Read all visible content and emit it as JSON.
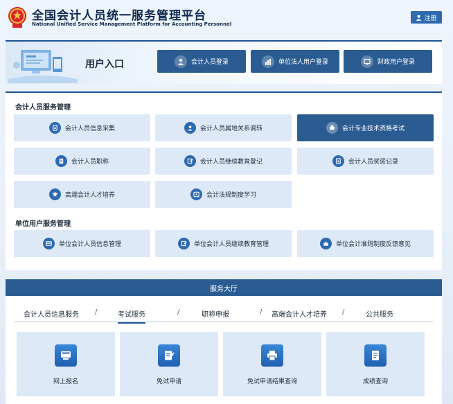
{
  "header": {
    "title": "全国会计人员统一服务管理平台",
    "subtitle": "National Unified Service Management Platform for Accounting Personnel",
    "register_label": "注册"
  },
  "login": {
    "title": "用户入口",
    "buttons": [
      {
        "label": "会计人员登录",
        "icon": "user-icon"
      },
      {
        "label": "单位法人用户登录",
        "icon": "building-icon"
      },
      {
        "label": "财政用户登录",
        "icon": "monitor-icon"
      }
    ]
  },
  "personnel_services": {
    "title": "会计人员服务管理",
    "items": [
      {
        "label": "会计人员信息采集",
        "icon": "form-icon"
      },
      {
        "label": "会计人员属地关系调转",
        "icon": "transfer-icon"
      },
      {
        "label": "会计专业技术资格考试",
        "icon": "exam-icon",
        "active": true
      },
      {
        "label": "会计人员职称",
        "icon": "document-icon"
      },
      {
        "label": "会计人员继续教育登记",
        "icon": "edit-icon"
      },
      {
        "label": "会计人员奖惩记录",
        "icon": "record-icon"
      },
      {
        "label": "高端会计人才培养",
        "icon": "graduation-icon"
      },
      {
        "label": "会计法规制度学习",
        "icon": "play-icon"
      }
    ]
  },
  "unit_services": {
    "title": "单位用户服务管理",
    "items": [
      {
        "label": "单位会计人员信息管理",
        "icon": "card-icon"
      },
      {
        "label": "单位会计人员继续教育管理",
        "icon": "edit-icon"
      },
      {
        "label": "单位会计准则制度反馈意见",
        "icon": "feedback-icon"
      }
    ]
  },
  "hall": {
    "title": "服务大厅",
    "tabs": [
      "会计人员信息服务",
      "考试服务",
      "职称申报",
      "高端会计人才培养",
      "公共服务"
    ],
    "separator": "/",
    "active_tab": "考试服务",
    "cards": [
      {
        "label": "网上报名",
        "icon": "computer-icon"
      },
      {
        "label": "免试申请",
        "icon": "edit-icon"
      },
      {
        "label": "免试申请结果查询",
        "icon": "printer-icon"
      },
      {
        "label": "成绩查询",
        "icon": "report-icon"
      }
    ]
  },
  "colors": {
    "primary": "#2a5c92",
    "tile": "#dde9f7",
    "accent": "#2e6ab0"
  }
}
